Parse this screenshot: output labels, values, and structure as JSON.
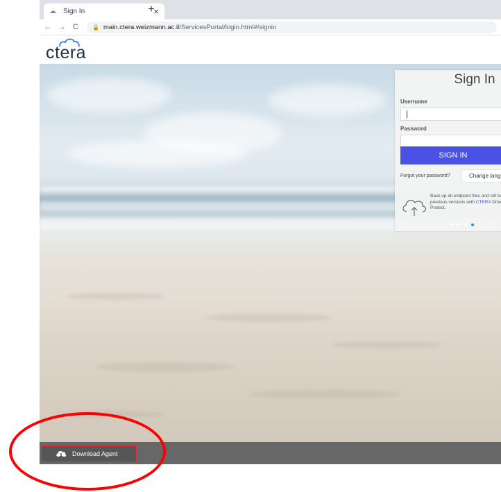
{
  "browser": {
    "tab_title": "Sign In",
    "tab_close": "×",
    "new_tab": "+",
    "url_host": "main.ctera.weizmann.ac.il",
    "url_path": "/ServicesPortal/login.html#/signin"
  },
  "header": {
    "logo_text": "ctera"
  },
  "signin": {
    "title": "Sign In",
    "username_label": "Username",
    "username_value": "|",
    "password_label": "Password",
    "password_value": "",
    "signin_button": "SIGN IN",
    "forgot_link": "Forgot your password?",
    "change_language_button": "Change language",
    "promo_text_1": "Back up all endpoint files and roll back to previous versions with ",
    "promo_brand": "CTERA",
    "promo_text_2": " Drive Protect.",
    "carousel_dots": 4,
    "carousel_active_index": 3
  },
  "footer": {
    "download_agent_label": "Download Agent"
  },
  "colors": {
    "accent": "#4a52e5",
    "annotation": "#ff0000",
    "footer_bg": "#464646"
  }
}
